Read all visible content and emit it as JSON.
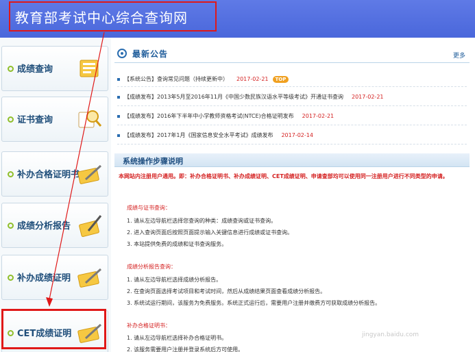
{
  "header": {
    "site_title": "教育部考试中心综合查询网"
  },
  "sidebar": {
    "items": [
      {
        "label": "成绩查询",
        "icon": "score-query-icon"
      },
      {
        "label": "证书查询",
        "icon": "certificate-search-icon"
      },
      {
        "label": "补办合格证明书",
        "icon": "pencil-document-icon"
      },
      {
        "label": "成绩分析报告",
        "icon": "report-pencil-icon"
      },
      {
        "label": "补办成绩证明",
        "icon": "pencil-document-icon"
      },
      {
        "label": "CET成绩证明",
        "icon": "pencil-document-icon"
      }
    ]
  },
  "notice": {
    "title": "最新公告",
    "more": "更多",
    "badge": "TOP",
    "items": [
      {
        "text": "【系统公告】查询常见问题（持续更新中）",
        "date": "2017-02-21"
      },
      {
        "text": "【成绩发布】2013年5月至2016年11月《中国少数民族汉语水平等级考试》开通证书查询",
        "date": "2017-02-21"
      },
      {
        "text": "【成绩发布】2016年下半年中小学教师资格考试(NTCE)合格证明发布",
        "date": "2017-02-21"
      },
      {
        "text": "【成绩发布】2017年1月《国家信息安全水平考试》成绩发布",
        "date": "2017-02-14"
      }
    ]
  },
  "steps": {
    "title": "系统操作步骤说明",
    "intro": "本网站内注册用户通用。即：补办合格证明书、补办成绩证明、CET成绩证明、申请查部均可以使用同一注册用户进行不同类型的申请。",
    "sections": [
      {
        "title": "成绩与证书查询：",
        "items": [
          "1.  请从左边导航栏选择您查询的种类：成绩查询或证书查询。",
          "2.  进入查询页面后按照页面提示输入关键信息进行成绩或证书查询。",
          "3.  本站提供免费的成绩和证书查询服务。"
        ]
      },
      {
        "title": "成绩分析报告查询：",
        "items": [
          "1.  请从左边导航栏选择成绩分析报告。",
          "2.  在查询页面选择考试项目和考试时间，然后从成绩结果页面查看成绩分析报告。",
          "3.  系统试运行期间，该服务为免费服务。系统正式运行后，需要用户注册并缴费方可获取成绩分析报告。"
        ]
      },
      {
        "title": "补办合格证明书：",
        "items": [
          "1.  请从左边导航栏选择补办合格证明书。",
          "2.  该服务需要用户注册并登录系统后方可使用。"
        ]
      }
    ]
  },
  "watermark": "jingyan.baidu.com",
  "colors": {
    "header_bg": "#4a67db",
    "highlight": "#e01818",
    "accent_red": "#d42020",
    "nav_text": "#1f4e7a"
  }
}
